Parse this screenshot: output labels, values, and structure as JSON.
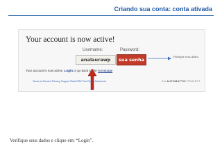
{
  "slide": {
    "title": "Criando sua conta: conta ativada",
    "caption": "Verifique seus dados e clique em: “Login”."
  },
  "account_page": {
    "heading": "Your account is now active!",
    "username_label": "Username:",
    "password_label": "Password:",
    "username_value": "analaurawp",
    "password_value": "sua senha",
    "callout": "Verifique seus dados",
    "active_text": "Your account is now active.",
    "login_link": "Login",
    "active_middle": "or go back to the",
    "homepage_link": "homepage",
    "footer_links": "Terms of Service   Privacy   Support   Stats   RSS   Fan Pages   Facebook",
    "brand_prefix": "AN",
    "brand_name": "AUTOMATTIC",
    "brand_suffix": "PROJECT"
  },
  "colors": {
    "title": "#1f5aa6",
    "password_highlight": "#c23a2a",
    "arrow": "#c0281c",
    "callout_arrow": "#3a6fc7"
  },
  "icons": {
    "red_arrow": "arrow-up-icon",
    "callout_arrow": "arrow-right-icon"
  }
}
